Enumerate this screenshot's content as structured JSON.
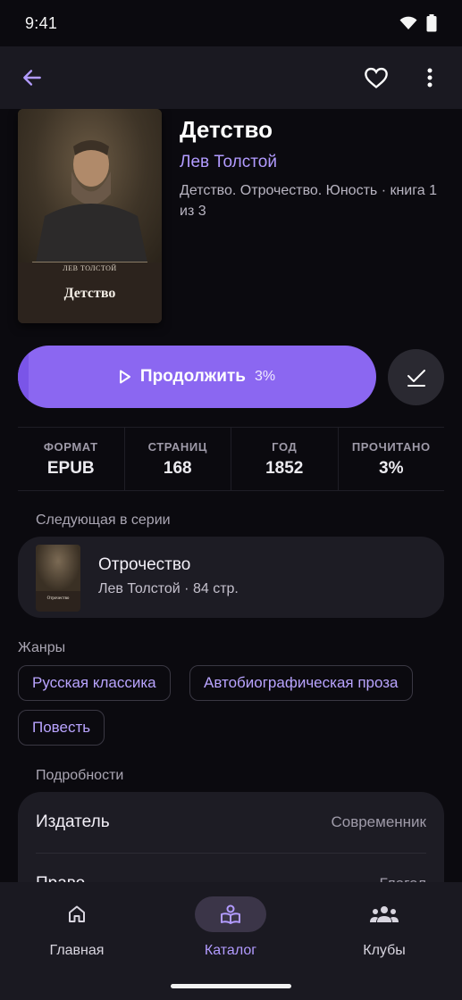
{
  "status_bar": {
    "time": "9:41"
  },
  "book": {
    "title": "Детство",
    "author": "Лев Толстой",
    "series_line": "Детство. Отрочество. Юность · книга 1 из 3",
    "cover": {
      "author": "ЛЕВ ТОЛСТОЙ",
      "title": "Детство"
    }
  },
  "actions": {
    "continue_label": "Продолжить",
    "progress_text": "3%",
    "progress": 0.03
  },
  "stats": [
    {
      "label": "ФОРМАТ",
      "value": "EPUB"
    },
    {
      "label": "СТРАНИЦ",
      "value": "168"
    },
    {
      "label": "ГОД",
      "value": "1852"
    },
    {
      "label": "ПРОЧИТАНО",
      "value": "3%"
    }
  ],
  "next_in_series": {
    "heading": "Следующая в серии",
    "title": "Отрочество",
    "meta": "Лев Толстой · 84 стр.",
    "cover_title": "Отрочество"
  },
  "genres": {
    "heading": "Жанры",
    "items": [
      "Русская классика",
      "Автобиографическая проза",
      "Повесть"
    ]
  },
  "details": {
    "heading": "Подробности",
    "rows": [
      {
        "key": "Издатель",
        "value": "Современник"
      },
      {
        "key": "Право",
        "value": "Глагол"
      }
    ]
  },
  "bottom_nav": {
    "items": [
      {
        "label": "Главная",
        "icon": "home-icon"
      },
      {
        "label": "Каталог",
        "icon": "book-reader-icon",
        "active": true
      },
      {
        "label": "Клубы",
        "icon": "group-icon"
      }
    ]
  },
  "colors": {
    "accent": "#8b67f1",
    "accent_text": "#b29bff",
    "background": "#0b0a0f",
    "surface": "#1d1c24"
  }
}
